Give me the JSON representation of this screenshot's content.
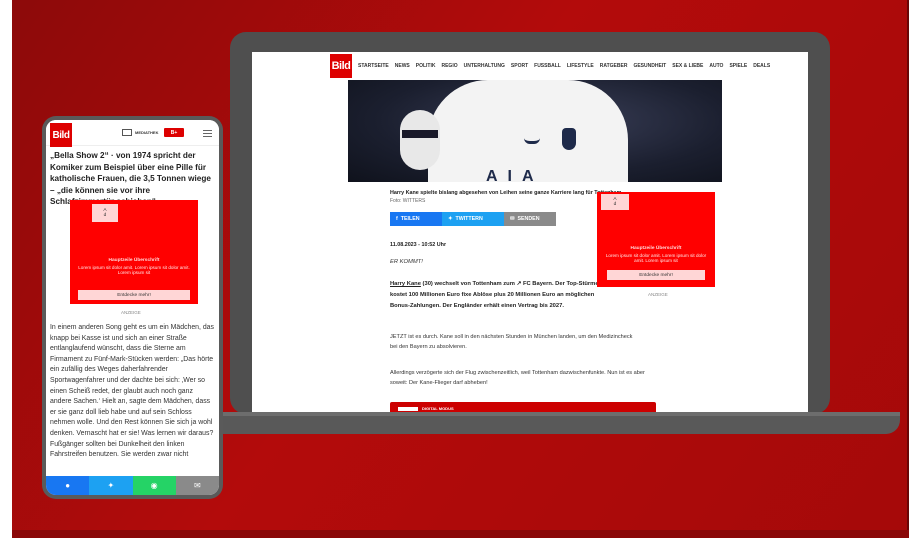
{
  "desktop": {
    "logo": "Bild",
    "nav": [
      "STARTSEITE",
      "NEWS",
      "POLITIK",
      "REGIO",
      "UNTERHALTUNG",
      "SPORT",
      "FUSSBALL",
      "LIFESTYLE",
      "RATGEBER",
      "GESUNDHEIT",
      "SEX & LIEBE",
      "AUTO",
      "SPIELE",
      "DEALS"
    ],
    "hero_letters": "AIA",
    "caption": "Harry Kane spielte bislang abgesehen von Leihen seine ganze Karriere lang für Tottenham",
    "credit": "Foto: WITTERS",
    "share": {
      "facebook": "TEILEN",
      "twitter": "TWITTERN",
      "mail": "SENDEN"
    },
    "date": "11.08.2023 - 10:52 Uhr",
    "kicker": "ER KOMMT!",
    "lead_name": "Harry Kane",
    "lead_rest": " (30) wechselt von Tottenham zum  ↗ FC Bayern. Der Top-Stürmer kostet 100 Millionen Euro fixe Ablöse plus 20 Millionen Euro an möglichen Bonus-Zahlungen. Der Engländer erhält einen Vertrag bis 2027.",
    "p1": "JETZT ist es durch. Kane soll in den nächsten Stunden in München landen, um den Medizincheck bei den Bayern zu absolvieren.",
    "p2": "Allerdings verzögerte sich der Flug zwischenzeitlich, weil Tottenham dazwischenfunkte. Nun ist es aber soweit: Der Kane-Flieger darf abheben!",
    "promo_text": "DIGITAL MODUS"
  },
  "ad": {
    "box_line1": "A",
    "box_line2": "d",
    "title": "Hauptzeile Überschrift",
    "body": "Lorem ipsum sit dolor amit. Lorem ipsum sit dolor amit. Lorem ipsum sit",
    "cta": "Entdecke mehr!",
    "label": "ANZEIGE"
  },
  "mobile": {
    "logo": "Bild",
    "mediathek": "MEDIATHEK",
    "bildplus": "B+",
    "bold_text": "„Bella Show 2“ · von 1974 spricht der Komiker zum Beispiel über eine Pille für katholische Frauen, die 3,5 Tonnen wiege – „die können sie vor ihre Schlafzimmertür schieben“.",
    "body": "In einem anderen Song geht es um ein Mädchen, das knapp bei Kasse ist und sich an einer Straße entlanglaufend wünscht, dass die Sterne am Firmament zu Fünf-Mark-Stücken werden: „Das hörte ein zufällig des Weges daherfahrender Sportwagenfahrer und der dachte bei sich: ‚Wer so einen Scheiß redet, der glaubt auch noch ganz andere Sachen.‘ Hielt an, sagte dem Mädchen, dass er sie ganz doll lieb habe und auf sein Schloss nehmen wolle. Und den Rest können Sie sich ja wohl denken. Vernascht hat er sie! Was lernen wir daraus? Fußgänger sollten bei Dunkelheit den linken Fahrstreifen benutzen. Sie werden zwar nicht",
    "share_colors": [
      "#1877f2",
      "#1da1f2",
      "#25d366",
      "#8a8a8a"
    ]
  }
}
